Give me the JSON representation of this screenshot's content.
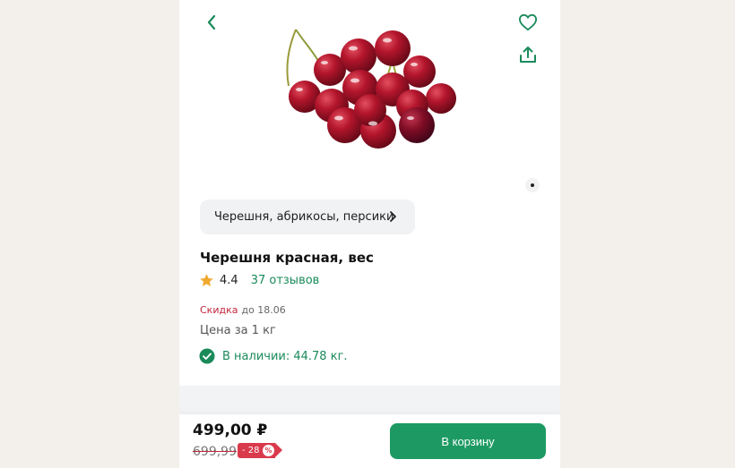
{
  "product": {
    "category": "Черешня, абрикосы, персики",
    "title": "Черешня красная, вес",
    "rating": "4.4",
    "reviews": "37 отзывов",
    "discount_label": "Скидка",
    "discount_until": "до 18.06",
    "unit_price_label": "Цена за 1 кг",
    "stock": "В наличии: 44.78 кг."
  },
  "price": {
    "current": "499,00 ₽",
    "old": "699,99",
    "discount_badge": "- 28",
    "discount_symbol": "%"
  },
  "actions": {
    "add_to_cart": "В корзину"
  },
  "icons": [
    "chevron-left-icon",
    "heart-icon",
    "share-icon",
    "chevron-right-icon",
    "star-icon",
    "check-circle-icon"
  ],
  "colors": {
    "accent": "#1d9a63",
    "discount": "#d93a4c",
    "background": "#f3efeb"
  }
}
